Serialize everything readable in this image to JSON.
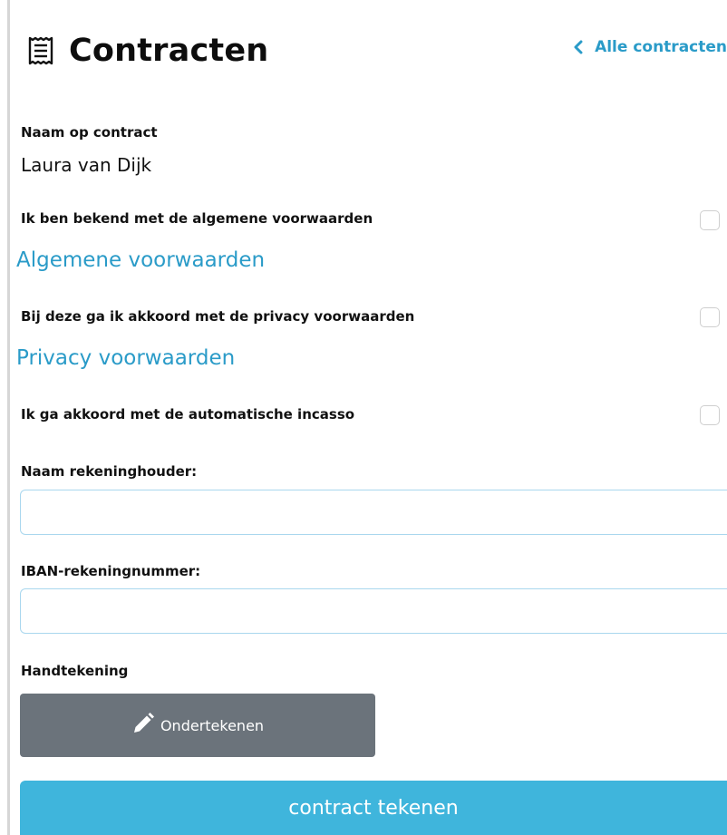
{
  "header": {
    "title": "Contracten",
    "icon": "receipt-icon",
    "back_link_label": "Alle contracten",
    "back_link_icon": "chevron-left-icon"
  },
  "contract": {
    "name_label": "Naam op contract",
    "name_value": "Laura van Dijk"
  },
  "agreements": [
    {
      "label": "Ik ben bekend met de algemene voorwaarden",
      "checked": false,
      "link_label": "Algemene voorwaarden"
    },
    {
      "label": "Bij deze ga ik akkoord met de privacy voorwaarden",
      "checked": false,
      "link_label": "Privacy voorwaarden"
    },
    {
      "label": "Ik ga akkoord met de automatische incasso",
      "checked": false
    }
  ],
  "account_holder": {
    "label": "Naam rekeninghouder:",
    "value": ""
  },
  "iban": {
    "label": "IBAN-rekeningnummer:",
    "value": ""
  },
  "signature": {
    "label": "Handtekening",
    "button_label": "Ondertekenen",
    "button_icon": "pencil-icon"
  },
  "submit": {
    "label": "contract tekenen"
  },
  "colors": {
    "accent": "#2a9bc8",
    "submit_bg": "#3fb5dc",
    "sign_bg": "#6b737b",
    "input_border": "#a9d7ee"
  }
}
